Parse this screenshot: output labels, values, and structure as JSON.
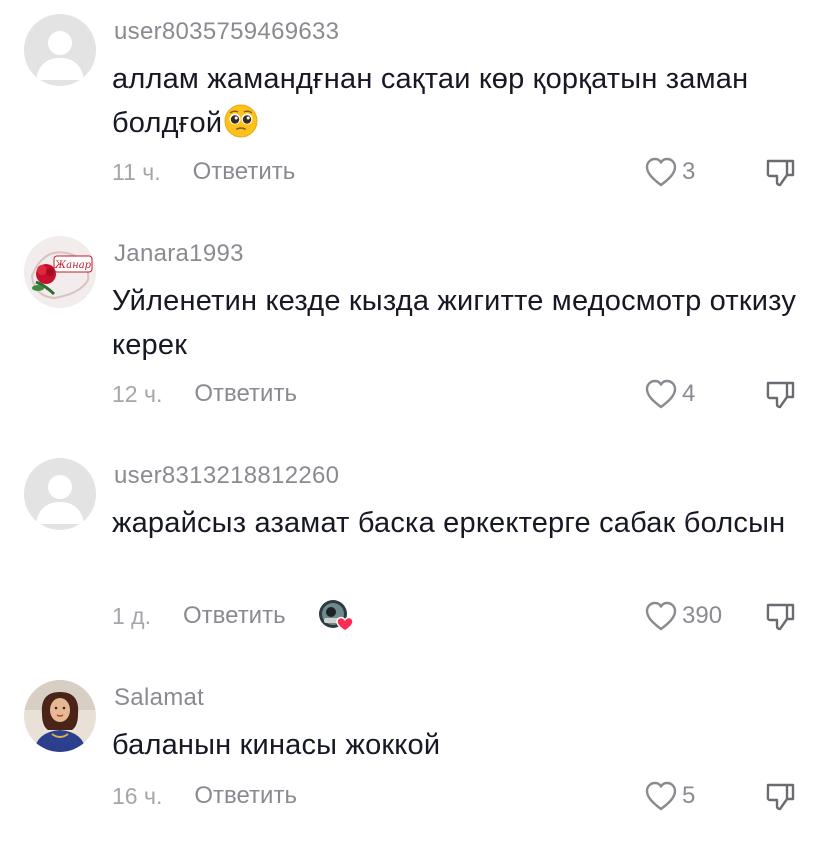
{
  "comments": [
    {
      "username": "user8035759469633",
      "text": "аллам жамандғнан сақтаи көр қорқатын заман болдғой",
      "emoji": "pleading-face",
      "time": "11 ч.",
      "reply_label": "Ответить",
      "likes": "3",
      "avatar": "default-avatar"
    },
    {
      "username": "Janara1993",
      "text": "Уйленетин кезде кызда жигитте медосмотр откизу керек",
      "time": "12 ч.",
      "reply_label": "Ответить",
      "likes": "4",
      "avatar": "photo-avatar",
      "avatar_caption": "Жанар"
    },
    {
      "username": "user8313218812260",
      "text": "жарайсыз азамат баска еркектерге сабак болсын",
      "time": "1 д.",
      "reply_label": "Ответить",
      "likes": "390",
      "avatar": "default-avatar",
      "liked_by_creator": true
    },
    {
      "username": "Salamat",
      "text": "баланын кинасы жоккой",
      "time": "16 ч.",
      "reply_label": "Ответить",
      "likes": "5",
      "avatar": "photo-avatar"
    }
  ],
  "colors": {
    "username": "#8a8b91",
    "text": "#161823",
    "meta": "#a5a6ab",
    "creator_heart": "#fe2c55"
  }
}
